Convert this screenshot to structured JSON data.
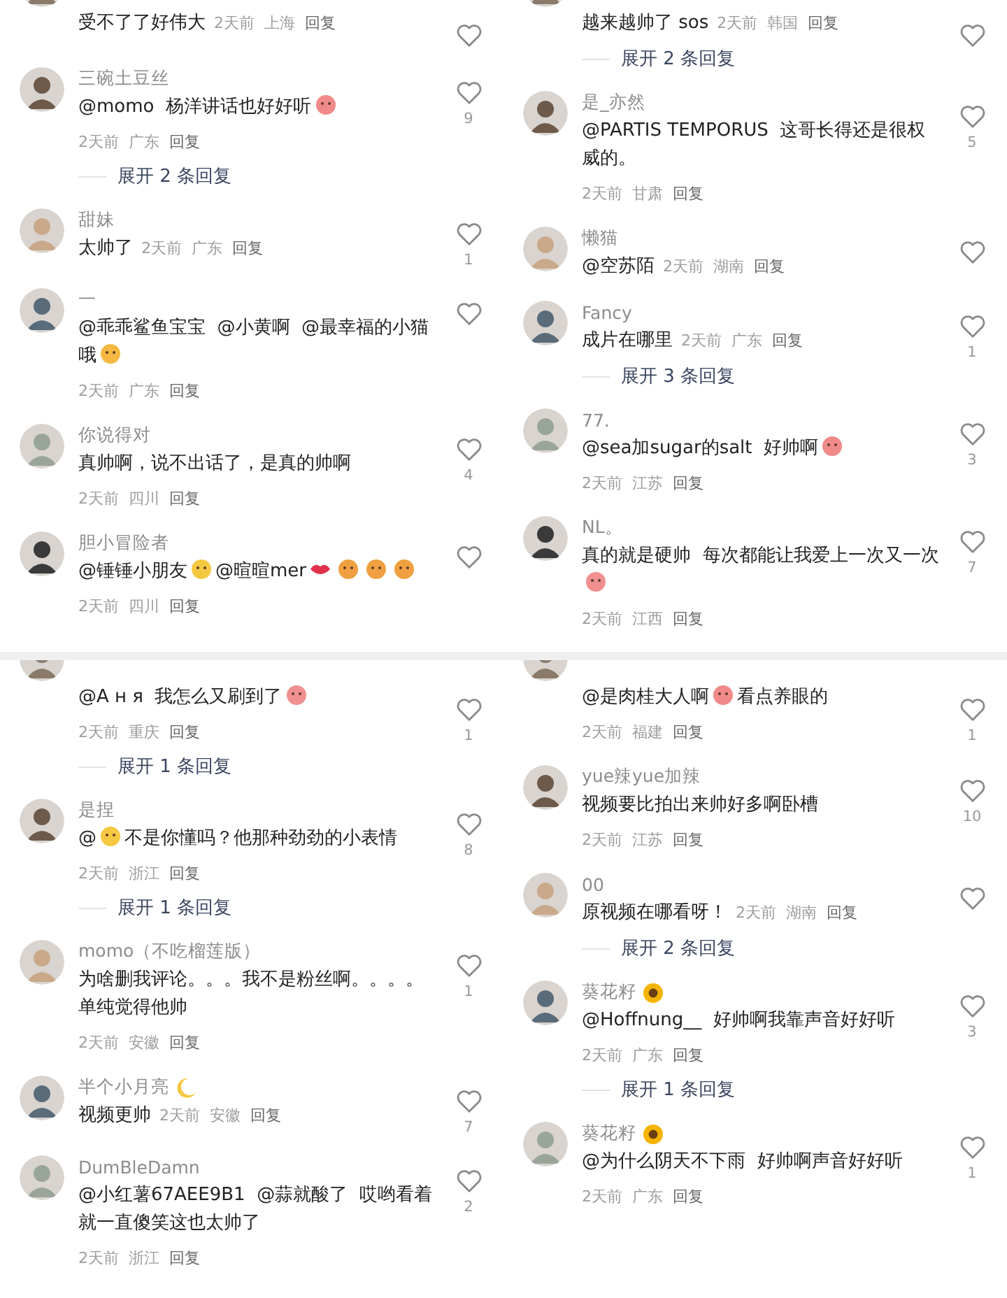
{
  "panels": [
    {
      "comments": [
        {
          "clipped": true,
          "body": [
            {
              "kind": "text",
              "text": "受不了了好伟大"
            }
          ],
          "meta": {
            "time": "2天前",
            "location": "上海",
            "reply": "回复"
          }
        },
        {
          "name": "三碗土豆丝",
          "body": [
            {
              "kind": "text",
              "text": "@momo  杨洋讲话也好好听"
            },
            {
              "kind": "face",
              "color": "#f08a8a"
            }
          ],
          "meta": {
            "time": "2天前",
            "location": "广东",
            "reply": "回复"
          },
          "likes": "9",
          "expand": "展开 2 条回复"
        },
        {
          "name": "甜妹",
          "body": [
            {
              "kind": "text",
              "text": "太帅了"
            }
          ],
          "meta": {
            "time": "2天前",
            "location": "广东",
            "reply": "回复"
          },
          "likes": "1"
        },
        {
          "name": "一",
          "body": [
            {
              "kind": "text",
              "text": "@乖乖鲨鱼宝宝  @小黄啊  @最幸福的小猫哦"
            },
            {
              "kind": "face",
              "color": "#f5b942"
            }
          ],
          "meta": {
            "time": "2天前",
            "location": "广东",
            "reply": "回复"
          }
        },
        {
          "name": "你说得对",
          "body": [
            {
              "kind": "text",
              "text": "真帅啊，说不出话了，是真的帅啊"
            }
          ],
          "meta": {
            "time": "2天前",
            "location": "四川",
            "reply": "回复"
          },
          "likes": "4"
        },
        {
          "name": "胆小冒险者",
          "body": [
            {
              "kind": "text",
              "text": "@锤锤小朋友"
            },
            {
              "kind": "face",
              "color": "#f5c842"
            },
            {
              "kind": "text",
              "text": "@暄暄mer"
            },
            {
              "kind": "lips",
              "color": "#e0304a"
            },
            {
              "kind": "face",
              "color": "#f0a040"
            },
            {
              "kind": "face",
              "color": "#f0a040"
            },
            {
              "kind": "face",
              "color": "#f0a040"
            }
          ],
          "meta": {
            "time": "2天前",
            "location": "四川",
            "reply": "回复"
          }
        }
      ]
    },
    {
      "comments": [
        {
          "clipped": true,
          "body": [
            {
              "kind": "text",
              "text": "越来越帅了 sos"
            }
          ],
          "meta": {
            "time": "2天前",
            "location": "韩国",
            "reply": "回复"
          },
          "expand": "展开 2 条回复"
        },
        {
          "name": "是_亦然",
          "body": [
            {
              "kind": "text",
              "text": "@PARTIS TEMPORUS  这哥长得还是很权威的。"
            }
          ],
          "meta": {
            "time": "2天前",
            "location": "甘肃",
            "reply": "回复"
          },
          "likes": "5"
        },
        {
          "name": "懒猫",
          "body": [
            {
              "kind": "text",
              "text": "@空苏陌"
            }
          ],
          "meta": {
            "time": "2天前",
            "location": "湖南",
            "reply": "回复"
          }
        },
        {
          "name": "Fancy",
          "body": [
            {
              "kind": "text",
              "text": "成片在哪里"
            }
          ],
          "meta": {
            "time": "2天前",
            "location": "广东",
            "reply": "回复"
          },
          "likes": "1",
          "expand": "展开 3 条回复"
        },
        {
          "name": "77.",
          "body": [
            {
              "kind": "text",
              "text": "@sea加sugar的salt  好帅啊"
            },
            {
              "kind": "face",
              "color": "#f08a8a"
            }
          ],
          "meta": {
            "time": "2天前",
            "location": "江苏",
            "reply": "回复"
          },
          "likes": "3"
        },
        {
          "name": "NL。",
          "body": [
            {
              "kind": "text",
              "text": "真的就是硬帅  每次都能让我爱上一次又一次"
            },
            {
              "kind": "face",
              "color": "#f09090"
            }
          ],
          "meta": {
            "time": "2天前",
            "location": "江西",
            "reply": "回复"
          },
          "likes": "7"
        }
      ]
    },
    {
      "comments": [
        {
          "clipped": true,
          "body": [
            {
              "kind": "text",
              "text": "@А н я  我怎么又刷到了"
            },
            {
              "kind": "face",
              "color": "#f09090"
            }
          ],
          "meta": {
            "time": "2天前",
            "location": "重庆",
            "reply": "回复"
          },
          "likes": "1",
          "expand": "展开 1 条回复"
        },
        {
          "name": "是捏",
          "body": [
            {
              "kind": "text",
              "text": "@"
            },
            {
              "kind": "face",
              "color": "#f5c842"
            },
            {
              "kind": "text",
              "text": "不是你懂吗？他那种劲劲的小表情"
            }
          ],
          "meta": {
            "time": "2天前",
            "location": "浙江",
            "reply": "回复"
          },
          "likes": "8",
          "expand": "展开 1 条回复"
        },
        {
          "name": "momo（不吃榴莲版）",
          "body": [
            {
              "kind": "text",
              "text": "为啥删我评论。。。我不是粉丝啊。。。。单纯觉得他帅"
            }
          ],
          "meta": {
            "time": "2天前",
            "location": "安徽",
            "reply": "回复"
          },
          "likes": "1"
        },
        {
          "name": "半个小月亮",
          "name_emoji": {
            "kind": "moon",
            "color": "#f5c842"
          },
          "body": [
            {
              "kind": "text",
              "text": "视频更帅"
            }
          ],
          "meta": {
            "time": "2天前",
            "location": "安徽",
            "reply": "回复"
          },
          "likes": "7"
        },
        {
          "name": "DumBleDamn",
          "body": [
            {
              "kind": "text",
              "text": "@小红薯67AEE9B1  @蒜就酸了  哎哟看着就一直傻笑这也太帅了"
            }
          ],
          "meta": {
            "time": "2天前",
            "location": "浙江",
            "reply": "回复"
          },
          "likes": "2"
        }
      ]
    },
    {
      "comments": [
        {
          "clipped": true,
          "body": [
            {
              "kind": "text",
              "text": "@是肉桂大人啊"
            },
            {
              "kind": "face",
              "color": "#f08a8a"
            },
            {
              "kind": "text",
              "text": "看点养眼的"
            }
          ],
          "meta": {
            "time": "2天前",
            "location": "福建",
            "reply": "回复"
          },
          "likes": "1"
        },
        {
          "name": "yue辣yue加辣",
          "body": [
            {
              "kind": "text",
              "text": "视频要比拍出来帅好多啊卧槽"
            }
          ],
          "meta": {
            "time": "2天前",
            "location": "江苏",
            "reply": "回复"
          },
          "likes": "10"
        },
        {
          "name": "00",
          "body": [
            {
              "kind": "text",
              "text": "原视频在哪看呀！"
            }
          ],
          "meta": {
            "time": "2天前",
            "location": "湖南",
            "reply": "回复"
          },
          "expand": "展开 2 条回复"
        },
        {
          "name": "葵花籽",
          "name_emoji": {
            "kind": "flower",
            "color": "#f5b400"
          },
          "body": [
            {
              "kind": "text",
              "text": "@Hoffnung__  好帅啊我靠声音好好听"
            }
          ],
          "meta": {
            "time": "2天前",
            "location": "广东",
            "reply": "回复"
          },
          "likes": "3",
          "expand": "展开 1 条回复"
        },
        {
          "name": "葵花籽",
          "name_emoji": {
            "kind": "flower",
            "color": "#f5b400"
          },
          "body": [
            {
              "kind": "text",
              "text": "@为什么阴天不下雨  好帅啊声音好好听"
            }
          ],
          "meta": {
            "time": "2天前",
            "location": "广东",
            "reply": "回复"
          },
          "likes": "1"
        }
      ]
    }
  ]
}
